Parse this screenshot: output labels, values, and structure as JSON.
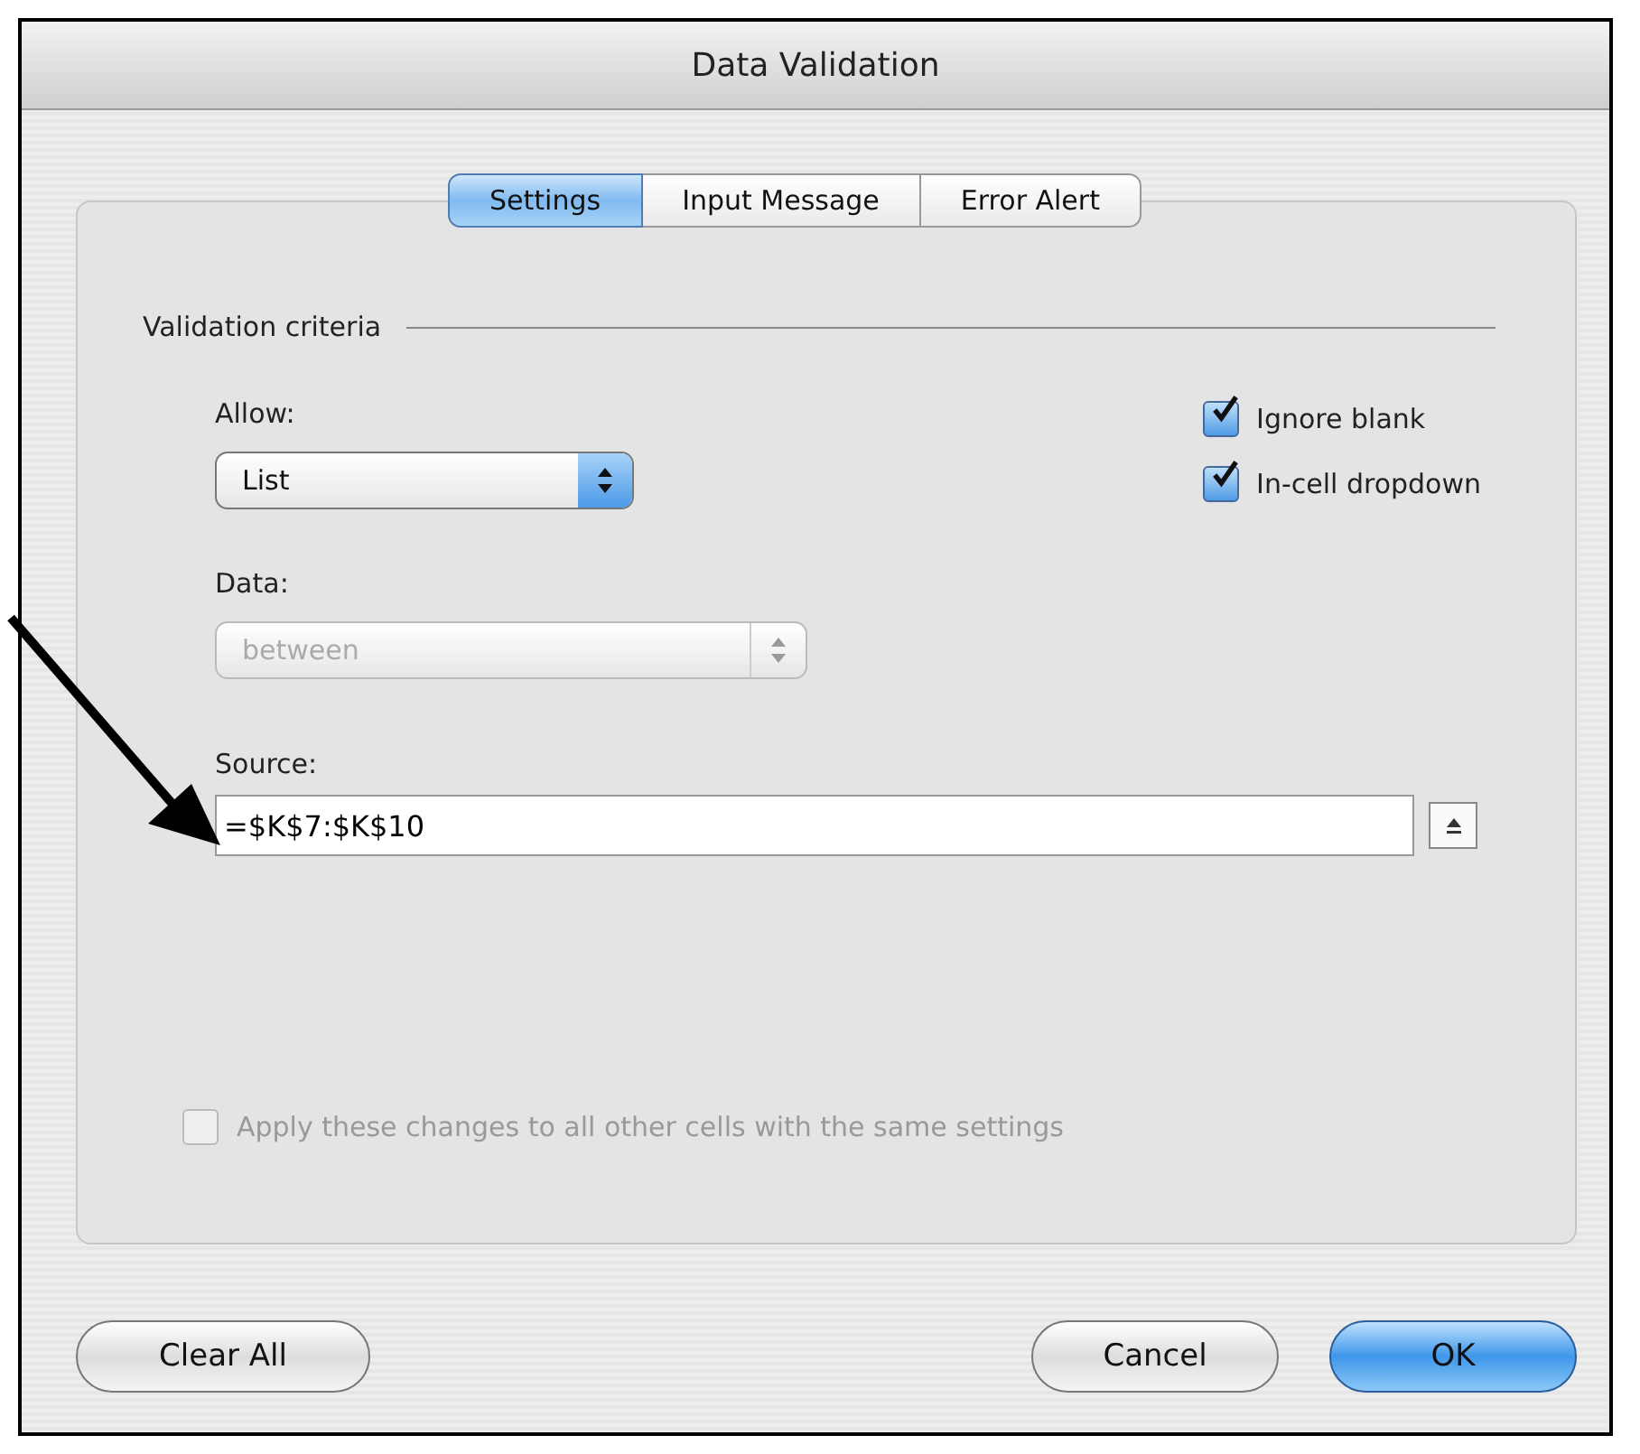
{
  "window": {
    "title": "Data Validation"
  },
  "tabs": [
    {
      "label": "Settings",
      "selected": true
    },
    {
      "label": "Input Message",
      "selected": false
    },
    {
      "label": "Error Alert",
      "selected": false
    }
  ],
  "criteria": {
    "heading": "Validation criteria",
    "allow": {
      "label": "Allow:",
      "value": "List",
      "disabled": false
    },
    "data": {
      "label": "Data:",
      "value": "between",
      "disabled": true
    },
    "checkboxes": [
      {
        "label": "Ignore blank",
        "checked": true,
        "disabled": false
      },
      {
        "label": "In-cell dropdown",
        "checked": true,
        "disabled": false
      }
    ],
    "source": {
      "label": "Source:",
      "value": "=$K$7:$K$10"
    }
  },
  "apply": {
    "label": "Apply these changes to all other cells with the same settings",
    "checked": false,
    "disabled": true
  },
  "buttons": [
    {
      "label": "Clear All",
      "kind": "plain"
    },
    {
      "label": "Cancel",
      "kind": "plain"
    },
    {
      "label": "OK",
      "kind": "default"
    }
  ]
}
